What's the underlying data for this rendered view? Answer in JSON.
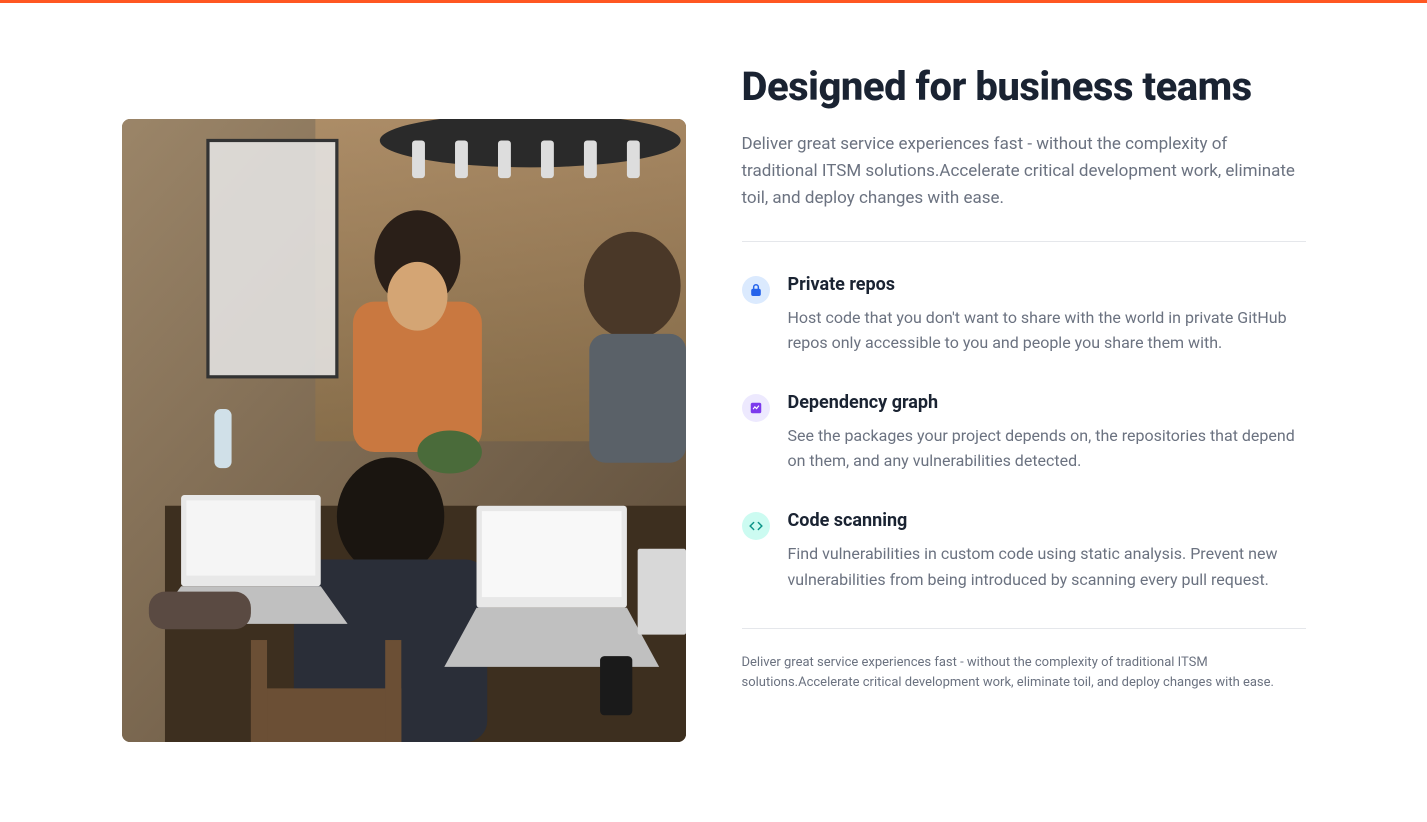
{
  "heading": "Designed for business teams",
  "subheading": "Deliver great service experiences fast - without the complexity of traditional ITSM solutions.Accelerate critical development work, eliminate toil, and deploy changes with ease.",
  "features": [
    {
      "icon": "lock-icon",
      "title": "Private repos",
      "description": "Host code that you don't want to share with the world in private GitHub repos only accessible to you and people you share them with."
    },
    {
      "icon": "chart-icon",
      "title": "Dependency graph",
      "description": "See the packages your project depends on, the repositories that depend on them, and any vulnerabilities detected."
    },
    {
      "icon": "code-icon",
      "title": "Code scanning",
      "description": "Find vulnerabilities in custom code using static analysis. Prevent new vulnerabilities from being introduced by scanning every pull request."
    }
  ],
  "footer_text": "Deliver great service experiences fast - without the complexity of traditional ITSM solutions.Accelerate critical development work, eliminate toil, and deploy changes with ease."
}
